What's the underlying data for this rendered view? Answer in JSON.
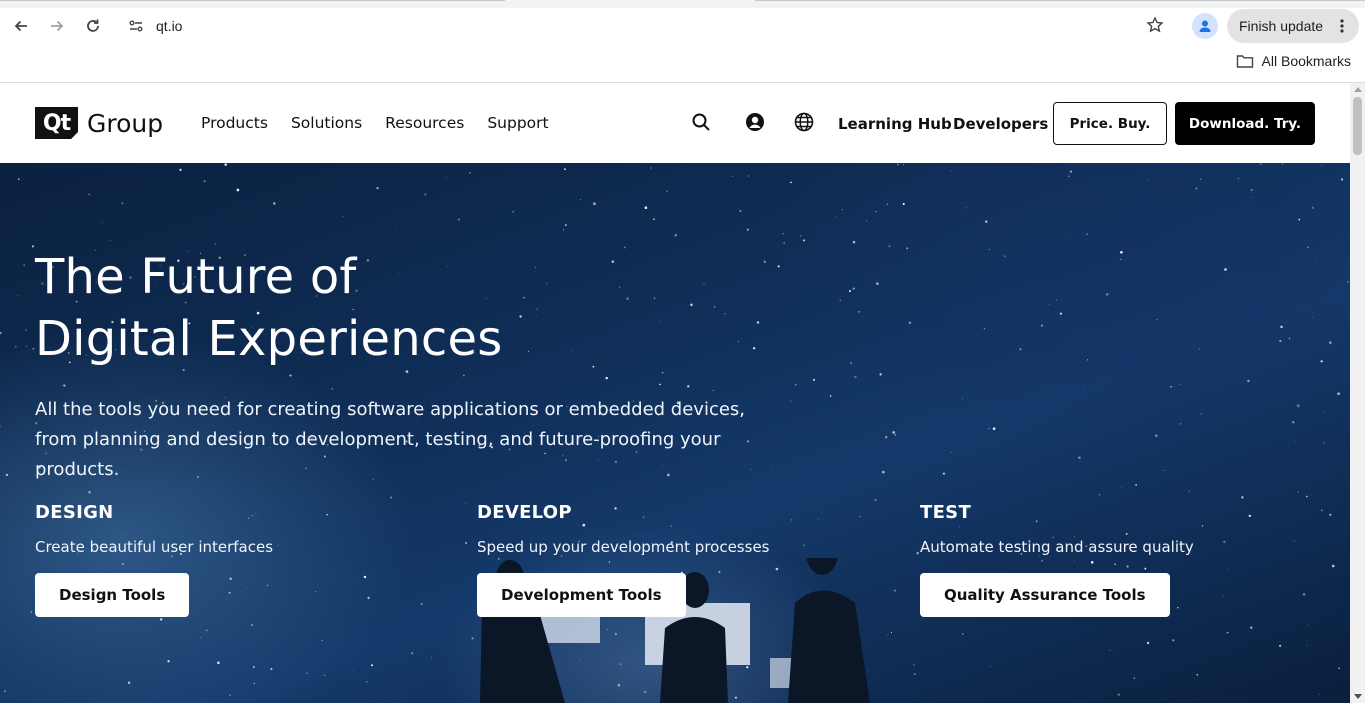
{
  "browser": {
    "url": "qt.io",
    "finish_update_label": "Finish update",
    "all_bookmarks_label": "All Bookmarks"
  },
  "header": {
    "logo_box": "Qt",
    "logo_text": "Group",
    "nav": [
      "Products",
      "Solutions",
      "Resources",
      "Support"
    ],
    "learning_hub": "Learning Hub",
    "developers": "Developers",
    "price_buy": "Price. Buy.",
    "download_try": "Download. Try."
  },
  "hero": {
    "title_line1": "The Future of",
    "title_line2": "Digital Experiences",
    "subtitle": "All the tools you need for creating software applications or embedded devices, from planning and design to development, testing, and future-proofing your products.",
    "columns": [
      {
        "heading": "DESIGN",
        "text": "Create beautiful user interfaces",
        "button": "Design Tools"
      },
      {
        "heading": "DEVELOP",
        "text": "Speed up your development processes",
        "button": "Development Tools"
      },
      {
        "heading": "TEST",
        "text": "Automate testing and assure quality",
        "button": "Quality Assurance Tools"
      }
    ]
  },
  "colors": {
    "hero_dark": "#0f2d55",
    "button_black": "#000000",
    "chrome_bg": "#f1f3f4"
  }
}
